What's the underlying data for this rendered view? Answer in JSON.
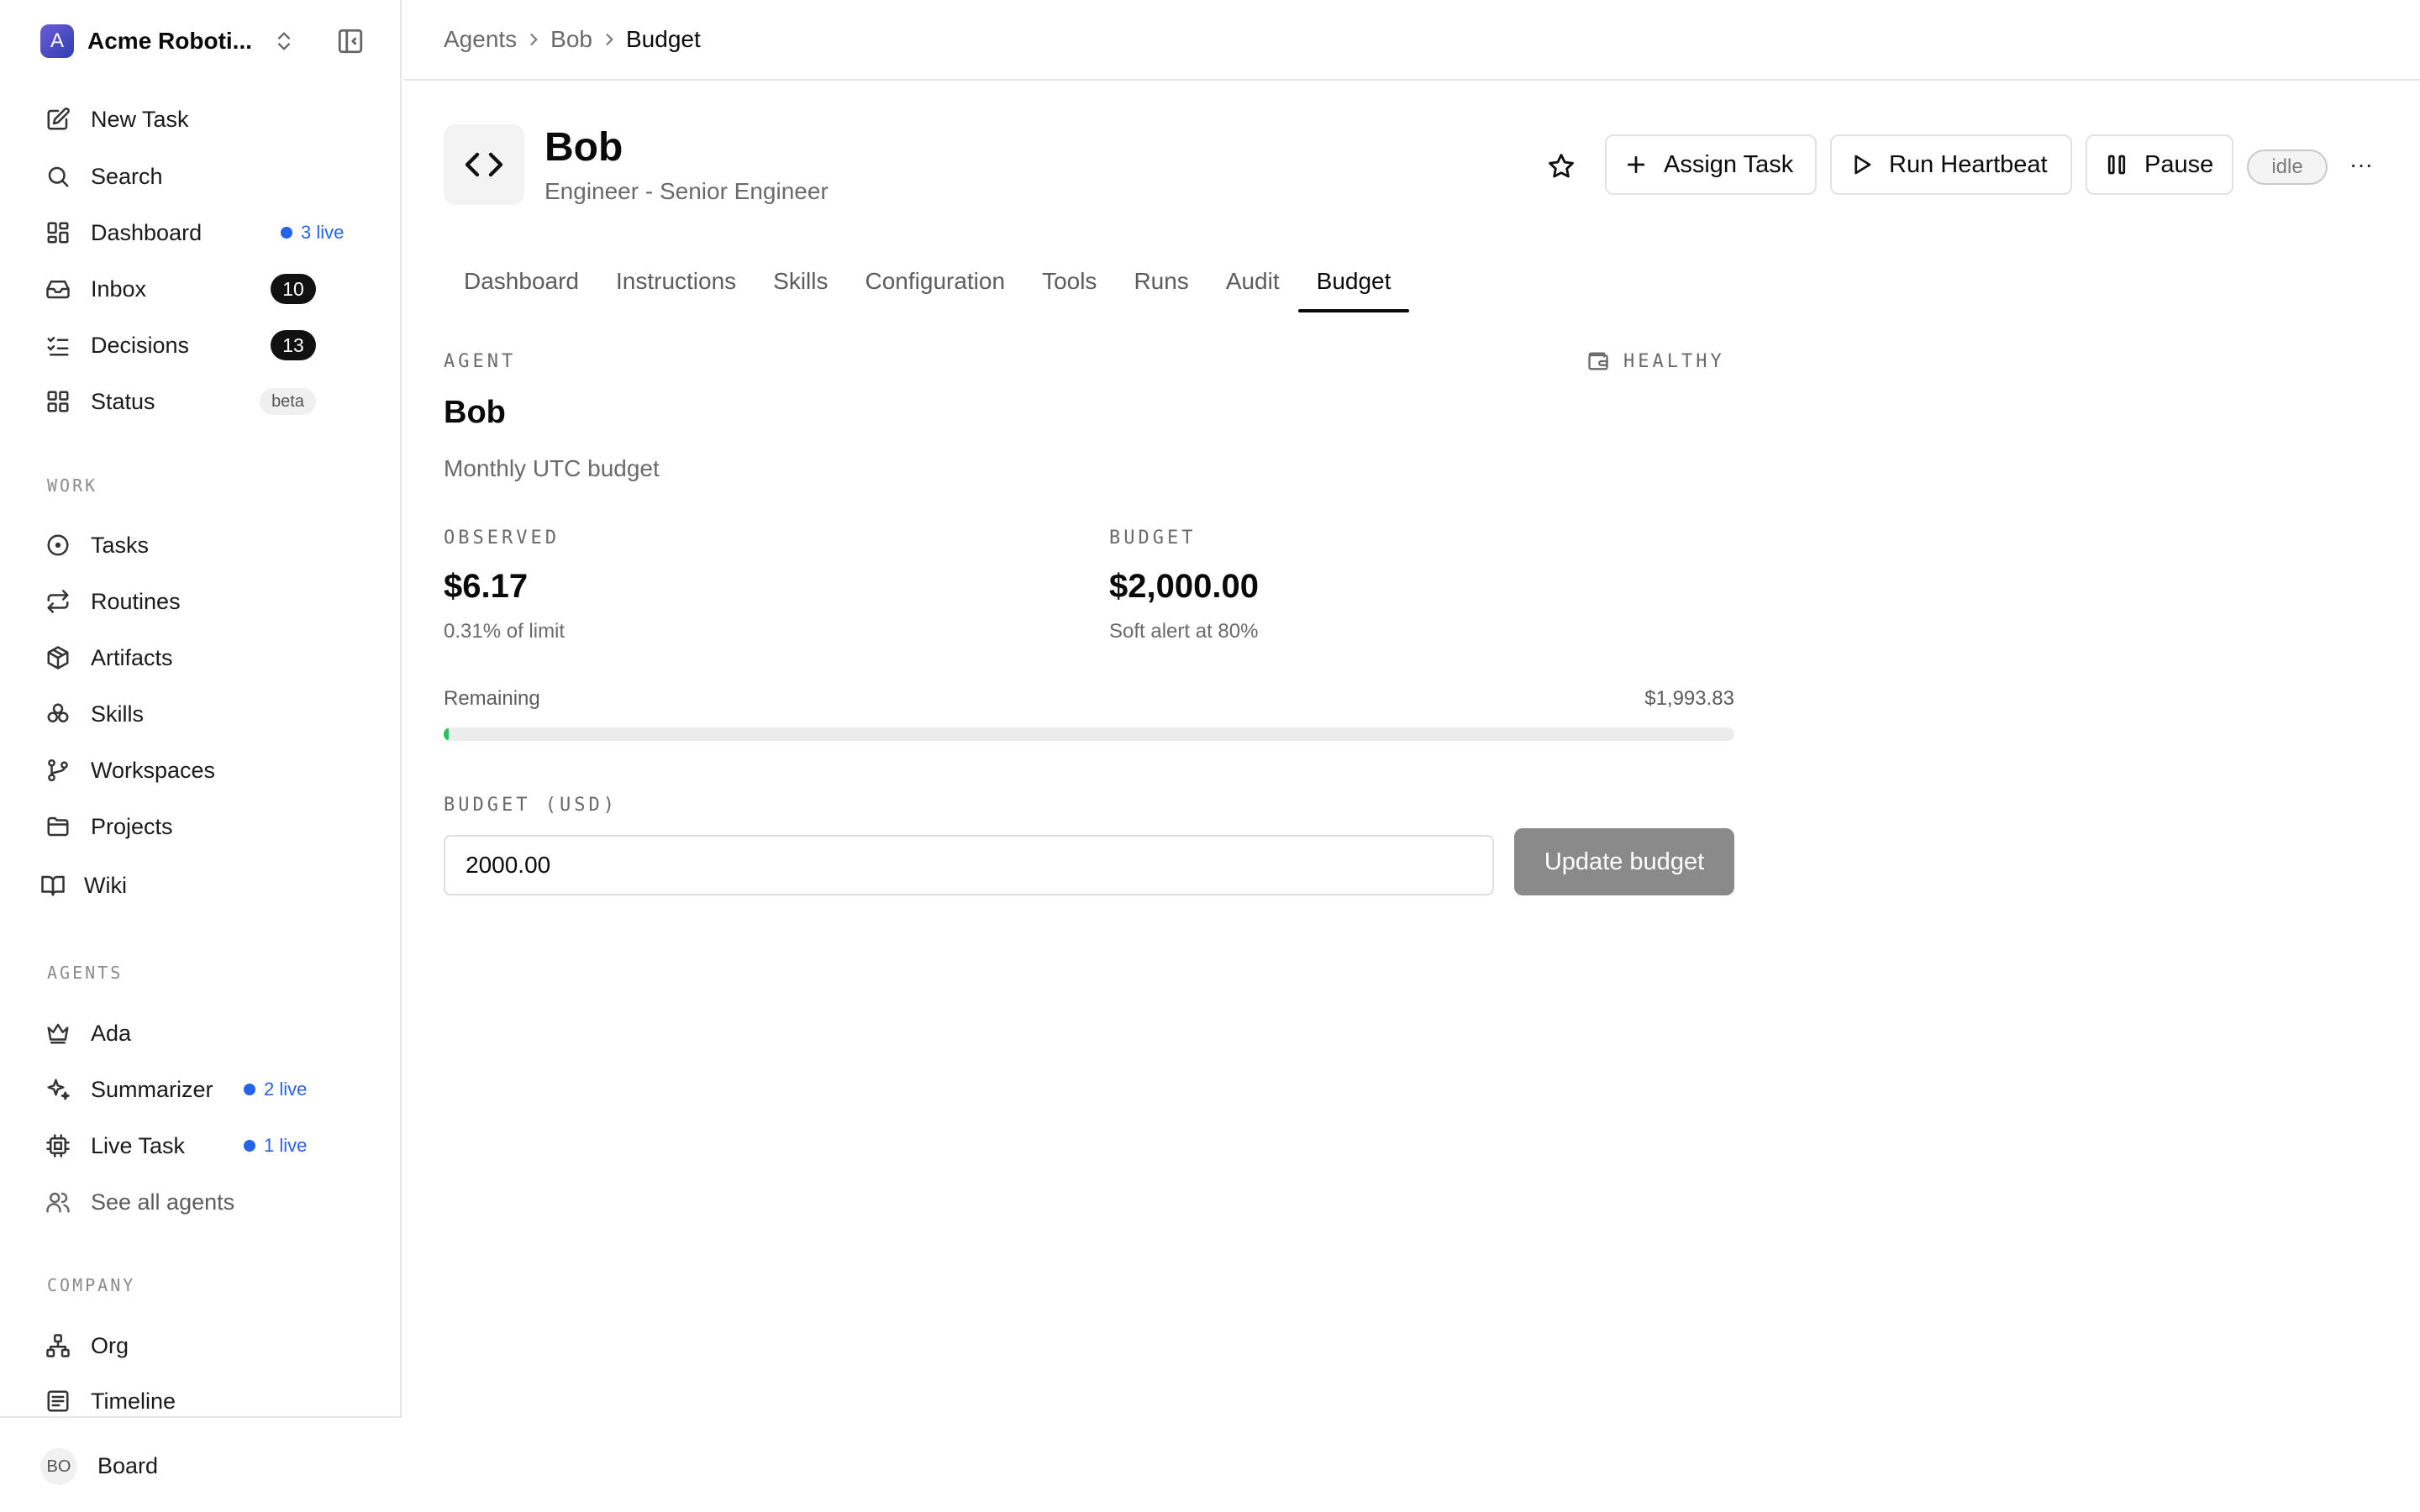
{
  "sidebar": {
    "brand": {
      "logo_letter": "A",
      "name": "Acme Roboti..."
    },
    "nav": [
      {
        "label": "New Task",
        "icon": "edit-icon"
      },
      {
        "label": "Search",
        "icon": "search-icon"
      },
      {
        "label": "Dashboard",
        "icon": "dashboard-icon",
        "live": "3 live"
      },
      {
        "label": "Inbox",
        "icon": "inbox-icon",
        "count": "10"
      },
      {
        "label": "Decisions",
        "icon": "checklist-icon",
        "count": "13"
      },
      {
        "label": "Status",
        "icon": "grid-icon",
        "badge": "beta"
      }
    ],
    "work_label": "WORK",
    "work": [
      {
        "label": "Tasks",
        "icon": "circle-dot-icon"
      },
      {
        "label": "Routines",
        "icon": "repeat-icon"
      },
      {
        "label": "Artifacts",
        "icon": "package-icon"
      },
      {
        "label": "Skills",
        "icon": "boxes-icon"
      },
      {
        "label": "Workspaces",
        "icon": "git-branch-icon"
      },
      {
        "label": "Projects",
        "icon": "folder-icon"
      },
      {
        "label": "Wiki",
        "icon": "book-icon"
      }
    ],
    "agents_label": "AGENTS",
    "agents": [
      {
        "label": "Ada",
        "icon": "crown-icon"
      },
      {
        "label": "Summarizer",
        "icon": "sparkles-icon",
        "live": "2 live"
      },
      {
        "label": "Live Task",
        "icon": "cpu-icon",
        "live": "1 live"
      },
      {
        "label": "See all agents",
        "icon": "users-icon"
      }
    ],
    "company_label": "COMPANY",
    "company": [
      {
        "label": "Org",
        "icon": "org-chart-icon"
      },
      {
        "label": "Timeline",
        "icon": "timeline-icon"
      }
    ],
    "footer": {
      "initials": "BO",
      "label": "Board"
    }
  },
  "breadcrumb": [
    "Agents",
    "Bob",
    "Budget"
  ],
  "agent": {
    "name": "Bob",
    "role": "Engineer - Senior Engineer",
    "status": "idle"
  },
  "actions": {
    "assign": "Assign Task",
    "heartbeat": "Run Heartbeat",
    "pause": "Pause",
    "more": "···"
  },
  "tabs": [
    "Dashboard",
    "Instructions",
    "Skills",
    "Configuration",
    "Tools",
    "Runs",
    "Audit",
    "Budget"
  ],
  "active_tab": "Budget",
  "budget": {
    "section_label": "AGENT",
    "health": "HEALTHY",
    "agent_name": "Bob",
    "period": "Monthly UTC budget",
    "observed_label": "OBSERVED",
    "observed_value": "$6.17",
    "observed_sub": "0.31% of limit",
    "budget_label": "BUDGET",
    "budget_value": "$2,000.00",
    "budget_sub": "Soft alert at 80%",
    "remaining_label": "Remaining",
    "remaining_value": "$1,993.83",
    "used_fraction": 0.0031,
    "input_label": "BUDGET (USD)",
    "input_value": "2000.00",
    "update_label": "Update budget"
  },
  "colors": {
    "live": "#2563eb",
    "progress": "#22c55e",
    "disabled_button": "#8a8a8a"
  }
}
